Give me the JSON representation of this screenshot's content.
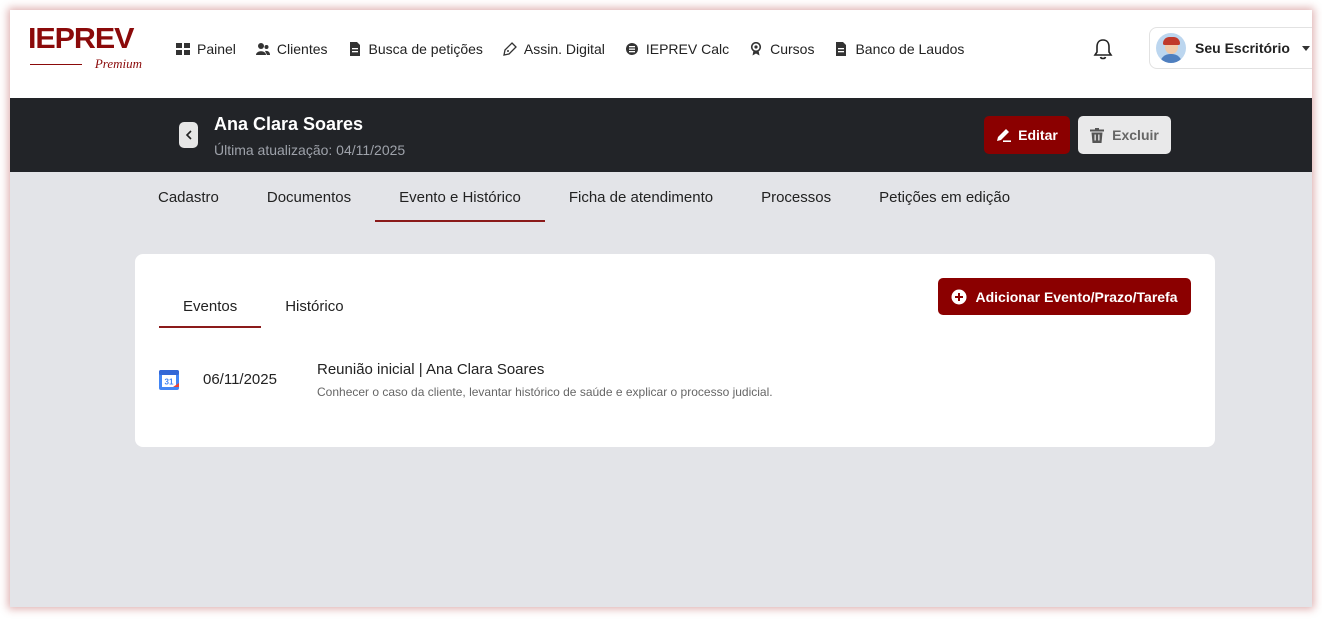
{
  "brand": {
    "logo_text": "IEPREV",
    "tier": "Premium",
    "color": "#8b0a0a"
  },
  "nav": {
    "items": [
      {
        "label": "Painel",
        "icon": "grid-icon"
      },
      {
        "label": "Clientes",
        "icon": "users-icon"
      },
      {
        "label": "Busca de petições",
        "icon": "document-icon"
      },
      {
        "label": "Assin. Digital",
        "icon": "pen-icon"
      },
      {
        "label": "IEPREV Calc",
        "icon": "coin-icon"
      },
      {
        "label": "Cursos",
        "icon": "award-icon"
      },
      {
        "label": "Banco de Laudos",
        "icon": "document-icon"
      }
    ],
    "notifications_icon": "bell-icon",
    "profile": {
      "name": "Seu Escritório",
      "icon": "avatar"
    }
  },
  "client": {
    "name": "Ana Clara Soares",
    "updated": "Última atualização: 04/11/2025",
    "edit_label": "Editar",
    "delete_label": "Excluir"
  },
  "tabs": [
    {
      "label": "Cadastro",
      "active": false
    },
    {
      "label": "Documentos",
      "active": false
    },
    {
      "label": "Evento e Histórico",
      "active": true
    },
    {
      "label": "Ficha de atendimento",
      "active": false
    },
    {
      "label": "Processos",
      "active": false
    },
    {
      "label": "Petições em edição",
      "active": false
    }
  ],
  "events_panel": {
    "subtabs": [
      {
        "label": "Eventos",
        "active": true
      },
      {
        "label": "Histórico",
        "active": false
      }
    ],
    "add_button_label": "Adicionar Evento/Prazo/Tarefa",
    "events": [
      {
        "date": "06/11/2025",
        "calendar_day": "31",
        "title": "Reunião inicial | Ana Clara Soares",
        "description": "Conhecer o caso da cliente, levantar histórico de saúde e explicar o processo judicial."
      }
    ]
  },
  "colors": {
    "accent": "#8b0000",
    "header_bg": "#222428",
    "page_bg": "#e3e4e8"
  }
}
